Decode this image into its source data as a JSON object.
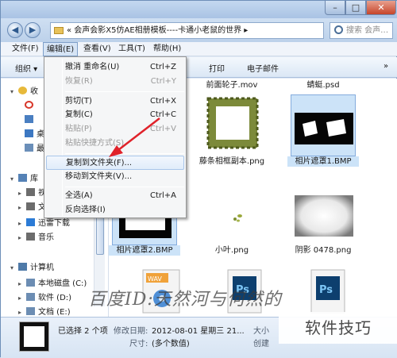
{
  "titlebar": {
    "minimize": "–",
    "maximize": "□",
    "close": "✕"
  },
  "address": {
    "path": "« 会声会影X5仿AE相册模板----卡通小老鼠的世界 ▸",
    "search_placeholder": "搜索 会声…"
  },
  "menubar": {
    "items": [
      "文件(F)",
      "编辑(E)",
      "查看(V)",
      "工具(T)",
      "帮助(H)"
    ],
    "active_index": 1
  },
  "toolbar": {
    "organize": "组织 ▾",
    "print": "打印",
    "email": "电子邮件",
    "more": "»"
  },
  "nav": {
    "items": [
      {
        "label": "收",
        "icon": "star-icon",
        "color": "#e7b93a"
      },
      {
        "label": "",
        "icon": "creative-cloud-icon",
        "color": "#d8382b"
      },
      {
        "label": "",
        "icon": "download-folder-icon",
        "color": "#4a7fc1"
      },
      {
        "label": "桌",
        "icon": "desktop-icon",
        "color": "#3d78c2"
      },
      {
        "label": "最",
        "icon": "recent-places-icon",
        "color": "#6b8fb9"
      },
      {
        "label": "库",
        "icon": "library-icon",
        "color": "#5582b6"
      },
      {
        "label": "视",
        "icon": "video-library-icon",
        "color": "#6c6c6c"
      },
      {
        "label": "文",
        "icon": "documents-icon",
        "color": "#6c6c6c"
      },
      {
        "label": "迅雷下载",
        "icon": "thunder-download-icon",
        "color": "#2b7bd6"
      },
      {
        "label": "音乐",
        "icon": "music-icon",
        "color": "#6c6c6c"
      },
      {
        "label": "计算机",
        "icon": "computer-icon",
        "color": "#4f7aa8"
      },
      {
        "label": "本地磁盘 (C:)",
        "icon": "drive-icon",
        "color": "#6c8db3"
      },
      {
        "label": "软件 (D:)",
        "icon": "drive-icon",
        "color": "#6c8db3"
      },
      {
        "label": "文档 (E:)",
        "icon": "drive-icon",
        "color": "#6c8db3"
      }
    ]
  },
  "context_menu": {
    "items": [
      {
        "label": "撤消 重命名(U)",
        "shortcut": "Ctrl+Z",
        "disabled": false
      },
      {
        "label": "恢复(R)",
        "shortcut": "Ctrl+Y",
        "disabled": true
      },
      {
        "label": "剪切(T)",
        "shortcut": "Ctrl+X",
        "disabled": false
      },
      {
        "label": "复制(C)",
        "shortcut": "Ctrl+C",
        "disabled": false
      },
      {
        "label": "粘贴(P)",
        "shortcut": "Ctrl+V",
        "disabled": true
      },
      {
        "label": "粘贴快捷方式(S)",
        "shortcut": "",
        "disabled": true
      },
      {
        "label": "复制到文件夹(F)...",
        "shortcut": "",
        "disabled": false
      },
      {
        "label": "移动到文件夹(V)...",
        "shortcut": "",
        "disabled": false
      },
      {
        "label": "全选(A)",
        "shortcut": "Ctrl+A",
        "disabled": false
      },
      {
        "label": "反向选择(I)",
        "shortcut": "",
        "disabled": false
      }
    ],
    "highlighted_index": 6
  },
  "files": [
    {
      "name": "前面轮子.mov",
      "selected": false
    },
    {
      "name": "蜻蜓.psd",
      "selected": false
    },
    {
      "name": "藤条相框副本.png",
      "selected": false
    },
    {
      "name": "相片遮罩1.BMP",
      "selected": true
    },
    {
      "name": "相片遮罩2.BMP",
      "selected": true
    },
    {
      "name": "小叶.png",
      "selected": false
    },
    {
      "name": "阴影 0478.png",
      "selected": false
    },
    {
      "name": "",
      "selected": false
    },
    {
      "name": "",
      "selected": false
    },
    {
      "name": "",
      "selected": false
    }
  ],
  "status": {
    "selected": "已选择 2 个项",
    "modified_label": "修改日期:",
    "modified_value": "2012-08-01 星期三 21...",
    "size_label": "大小",
    "dims_label": "尺寸:",
    "dims_value": "(多个数值)",
    "created_label": "创建"
  },
  "watermarks": {
    "baidu": "百度ID:天然河与何然的",
    "site": "软件技巧"
  },
  "colors": {
    "selection": "#cce3f8",
    "arrow": "#e0222a",
    "ps_blue": "#0d3f6e"
  }
}
